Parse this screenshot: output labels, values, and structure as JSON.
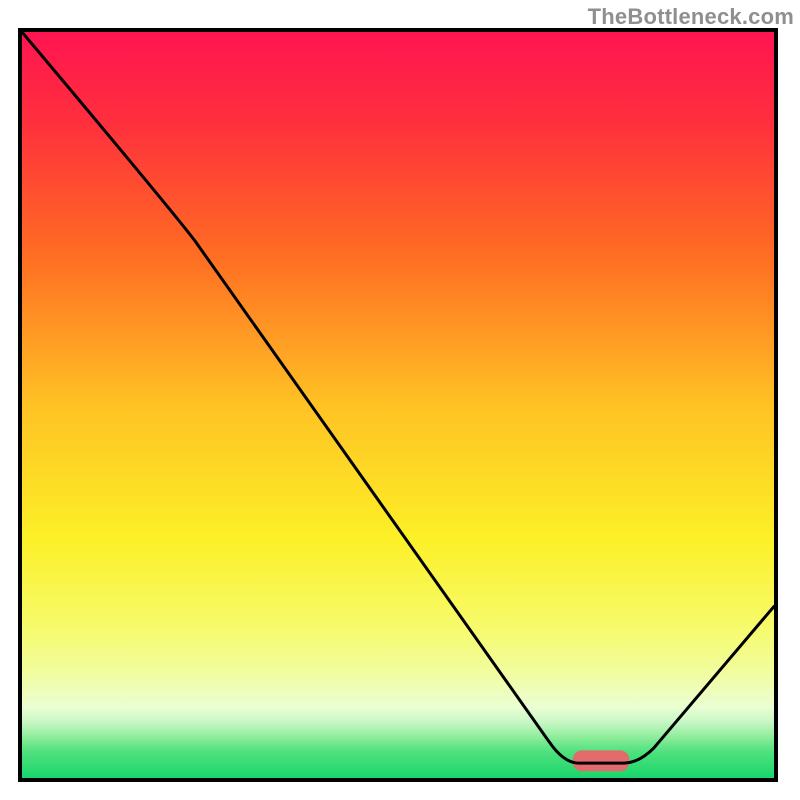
{
  "watermark": "TheBottleneck.com",
  "chart_data": {
    "type": "line",
    "title": "",
    "xlabel": "",
    "ylabel": "",
    "xlim": [
      0,
      100
    ],
    "ylim": [
      0,
      100
    ],
    "gradient": {
      "orientation": "vertical",
      "stops": [
        {
          "offset": 0.0,
          "color": "#ff1551"
        },
        {
          "offset": 0.12,
          "color": "#ff2f3d"
        },
        {
          "offset": 0.3,
          "color": "#ff6d23"
        },
        {
          "offset": 0.5,
          "color": "#ffc224"
        },
        {
          "offset": 0.68,
          "color": "#fcf027"
        },
        {
          "offset": 0.8,
          "color": "#f6fb6d"
        },
        {
          "offset": 0.86,
          "color": "#f1fda0"
        },
        {
          "offset": 0.905,
          "color": "#eafed3"
        },
        {
          "offset": 0.925,
          "color": "#c8f7c5"
        },
        {
          "offset": 0.945,
          "color": "#8eed9b"
        },
        {
          "offset": 0.965,
          "color": "#4fe17d"
        },
        {
          "offset": 1.0,
          "color": "#19d66c"
        }
      ]
    },
    "series": [
      {
        "name": "bottleneck-curve",
        "stroke": "#000000",
        "stroke_width": 3,
        "points": [
          {
            "x": 0,
            "y": 100
          },
          {
            "x": 20,
            "y": 76
          },
          {
            "x": 23,
            "y": 72
          },
          {
            "x": 70,
            "y": 5
          },
          {
            "x": 74,
            "y": 2
          },
          {
            "x": 80,
            "y": 2
          },
          {
            "x": 84,
            "y": 4
          },
          {
            "x": 100,
            "y": 23
          }
        ]
      }
    ],
    "marker": {
      "name": "optimal-region",
      "shape": "rounded-rect",
      "x_center": 77,
      "y_center": 2.3,
      "width": 7.5,
      "height": 2.8,
      "color": "#e46b6b"
    }
  }
}
